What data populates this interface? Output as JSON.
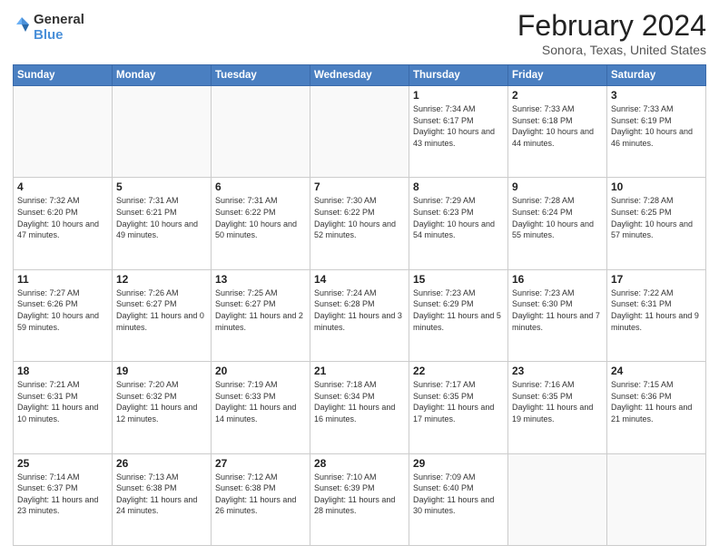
{
  "header": {
    "logo_general": "General",
    "logo_blue": "Blue",
    "month_title": "February 2024",
    "subtitle": "Sonora, Texas, United States"
  },
  "weekdays": [
    "Sunday",
    "Monday",
    "Tuesday",
    "Wednesday",
    "Thursday",
    "Friday",
    "Saturday"
  ],
  "weeks": [
    [
      {
        "day": "",
        "sunrise": "",
        "sunset": "",
        "daylight": ""
      },
      {
        "day": "",
        "sunrise": "",
        "sunset": "",
        "daylight": ""
      },
      {
        "day": "",
        "sunrise": "",
        "sunset": "",
        "daylight": ""
      },
      {
        "day": "",
        "sunrise": "",
        "sunset": "",
        "daylight": ""
      },
      {
        "day": "1",
        "sunrise": "Sunrise: 7:34 AM",
        "sunset": "Sunset: 6:17 PM",
        "daylight": "Daylight: 10 hours and 43 minutes."
      },
      {
        "day": "2",
        "sunrise": "Sunrise: 7:33 AM",
        "sunset": "Sunset: 6:18 PM",
        "daylight": "Daylight: 10 hours and 44 minutes."
      },
      {
        "day": "3",
        "sunrise": "Sunrise: 7:33 AM",
        "sunset": "Sunset: 6:19 PM",
        "daylight": "Daylight: 10 hours and 46 minutes."
      }
    ],
    [
      {
        "day": "4",
        "sunrise": "Sunrise: 7:32 AM",
        "sunset": "Sunset: 6:20 PM",
        "daylight": "Daylight: 10 hours and 47 minutes."
      },
      {
        "day": "5",
        "sunrise": "Sunrise: 7:31 AM",
        "sunset": "Sunset: 6:21 PM",
        "daylight": "Daylight: 10 hours and 49 minutes."
      },
      {
        "day": "6",
        "sunrise": "Sunrise: 7:31 AM",
        "sunset": "Sunset: 6:22 PM",
        "daylight": "Daylight: 10 hours and 50 minutes."
      },
      {
        "day": "7",
        "sunrise": "Sunrise: 7:30 AM",
        "sunset": "Sunset: 6:22 PM",
        "daylight": "Daylight: 10 hours and 52 minutes."
      },
      {
        "day": "8",
        "sunrise": "Sunrise: 7:29 AM",
        "sunset": "Sunset: 6:23 PM",
        "daylight": "Daylight: 10 hours and 54 minutes."
      },
      {
        "day": "9",
        "sunrise": "Sunrise: 7:28 AM",
        "sunset": "Sunset: 6:24 PM",
        "daylight": "Daylight: 10 hours and 55 minutes."
      },
      {
        "day": "10",
        "sunrise": "Sunrise: 7:28 AM",
        "sunset": "Sunset: 6:25 PM",
        "daylight": "Daylight: 10 hours and 57 minutes."
      }
    ],
    [
      {
        "day": "11",
        "sunrise": "Sunrise: 7:27 AM",
        "sunset": "Sunset: 6:26 PM",
        "daylight": "Daylight: 10 hours and 59 minutes."
      },
      {
        "day": "12",
        "sunrise": "Sunrise: 7:26 AM",
        "sunset": "Sunset: 6:27 PM",
        "daylight": "Daylight: 11 hours and 0 minutes."
      },
      {
        "day": "13",
        "sunrise": "Sunrise: 7:25 AM",
        "sunset": "Sunset: 6:27 PM",
        "daylight": "Daylight: 11 hours and 2 minutes."
      },
      {
        "day": "14",
        "sunrise": "Sunrise: 7:24 AM",
        "sunset": "Sunset: 6:28 PM",
        "daylight": "Daylight: 11 hours and 3 minutes."
      },
      {
        "day": "15",
        "sunrise": "Sunrise: 7:23 AM",
        "sunset": "Sunset: 6:29 PM",
        "daylight": "Daylight: 11 hours and 5 minutes."
      },
      {
        "day": "16",
        "sunrise": "Sunrise: 7:23 AM",
        "sunset": "Sunset: 6:30 PM",
        "daylight": "Daylight: 11 hours and 7 minutes."
      },
      {
        "day": "17",
        "sunrise": "Sunrise: 7:22 AM",
        "sunset": "Sunset: 6:31 PM",
        "daylight": "Daylight: 11 hours and 9 minutes."
      }
    ],
    [
      {
        "day": "18",
        "sunrise": "Sunrise: 7:21 AM",
        "sunset": "Sunset: 6:31 PM",
        "daylight": "Daylight: 11 hours and 10 minutes."
      },
      {
        "day": "19",
        "sunrise": "Sunrise: 7:20 AM",
        "sunset": "Sunset: 6:32 PM",
        "daylight": "Daylight: 11 hours and 12 minutes."
      },
      {
        "day": "20",
        "sunrise": "Sunrise: 7:19 AM",
        "sunset": "Sunset: 6:33 PM",
        "daylight": "Daylight: 11 hours and 14 minutes."
      },
      {
        "day": "21",
        "sunrise": "Sunrise: 7:18 AM",
        "sunset": "Sunset: 6:34 PM",
        "daylight": "Daylight: 11 hours and 16 minutes."
      },
      {
        "day": "22",
        "sunrise": "Sunrise: 7:17 AM",
        "sunset": "Sunset: 6:35 PM",
        "daylight": "Daylight: 11 hours and 17 minutes."
      },
      {
        "day": "23",
        "sunrise": "Sunrise: 7:16 AM",
        "sunset": "Sunset: 6:35 PM",
        "daylight": "Daylight: 11 hours and 19 minutes."
      },
      {
        "day": "24",
        "sunrise": "Sunrise: 7:15 AM",
        "sunset": "Sunset: 6:36 PM",
        "daylight": "Daylight: 11 hours and 21 minutes."
      }
    ],
    [
      {
        "day": "25",
        "sunrise": "Sunrise: 7:14 AM",
        "sunset": "Sunset: 6:37 PM",
        "daylight": "Daylight: 11 hours and 23 minutes."
      },
      {
        "day": "26",
        "sunrise": "Sunrise: 7:13 AM",
        "sunset": "Sunset: 6:38 PM",
        "daylight": "Daylight: 11 hours and 24 minutes."
      },
      {
        "day": "27",
        "sunrise": "Sunrise: 7:12 AM",
        "sunset": "Sunset: 6:38 PM",
        "daylight": "Daylight: 11 hours and 26 minutes."
      },
      {
        "day": "28",
        "sunrise": "Sunrise: 7:10 AM",
        "sunset": "Sunset: 6:39 PM",
        "daylight": "Daylight: 11 hours and 28 minutes."
      },
      {
        "day": "29",
        "sunrise": "Sunrise: 7:09 AM",
        "sunset": "Sunset: 6:40 PM",
        "daylight": "Daylight: 11 hours and 30 minutes."
      },
      {
        "day": "",
        "sunrise": "",
        "sunset": "",
        "daylight": ""
      },
      {
        "day": "",
        "sunrise": "",
        "sunset": "",
        "daylight": ""
      }
    ]
  ]
}
